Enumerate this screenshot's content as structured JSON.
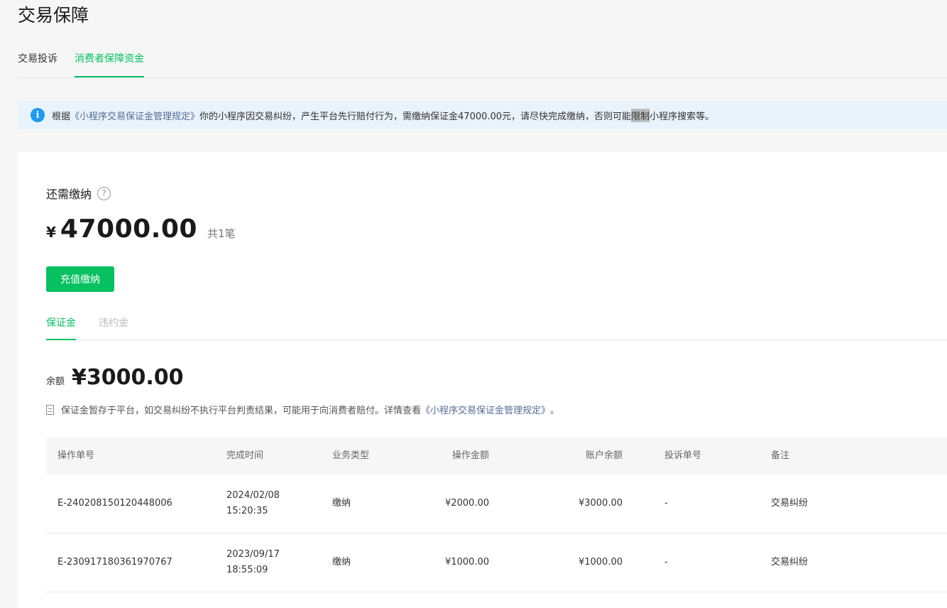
{
  "page_title": "交易保障",
  "top_tabs": [
    {
      "label": "交易投诉",
      "active": false
    },
    {
      "label": "消费者保障资金",
      "active": true
    }
  ],
  "notice": {
    "prefix": "根据 ",
    "link": "《小程序交易保证金管理规定》",
    "middle": "你的小程序因交易纠纷，产生平台先行赔付行为，需缴纳保证金47000.00元，请尽快完成缴纳，否则可能",
    "highlight": "限制",
    "suffix": "小程序搜索等。"
  },
  "due": {
    "label": "还需缴纳",
    "currency": "¥",
    "amount": "47000.00",
    "count": "共1笔"
  },
  "pay_button": "充值缴纳",
  "sub_tabs": [
    {
      "label": "保证金",
      "active": true
    },
    {
      "label": "违约金",
      "active": false
    }
  ],
  "balance": {
    "label": "余额",
    "amount": "¥3000.00"
  },
  "hint": {
    "text": "保证金暂存于平台，如交易纠纷不执行平台判责结果，可能用于向消费者赔付。详情查看 ",
    "link": "《小程序交易保证金管理规定》",
    "end": "。"
  },
  "table": {
    "headers": [
      "操作单号",
      "完成时间",
      "业务类型",
      "操作金额",
      "账户余额",
      "投诉单号",
      "备注"
    ],
    "rows": [
      {
        "id": "E-240208150120448006",
        "date": "2024/02/08",
        "time": "15:20:35",
        "type": "缴纳",
        "amount": "¥2000.00",
        "balance": "¥3000.00",
        "complaint": "-",
        "note": "交易纠纷"
      },
      {
        "id": "E-230917180361970767",
        "date": "2023/09/17",
        "time": "18:55:09",
        "type": "缴纳",
        "amount": "¥1000.00",
        "balance": "¥1000.00",
        "complaint": "-",
        "note": "交易纠纷"
      }
    ]
  },
  "colors": {
    "accent": "#07c160",
    "info": "#1e9af5",
    "link": "#576b95",
    "notice_bg": "#e8f3fb"
  }
}
